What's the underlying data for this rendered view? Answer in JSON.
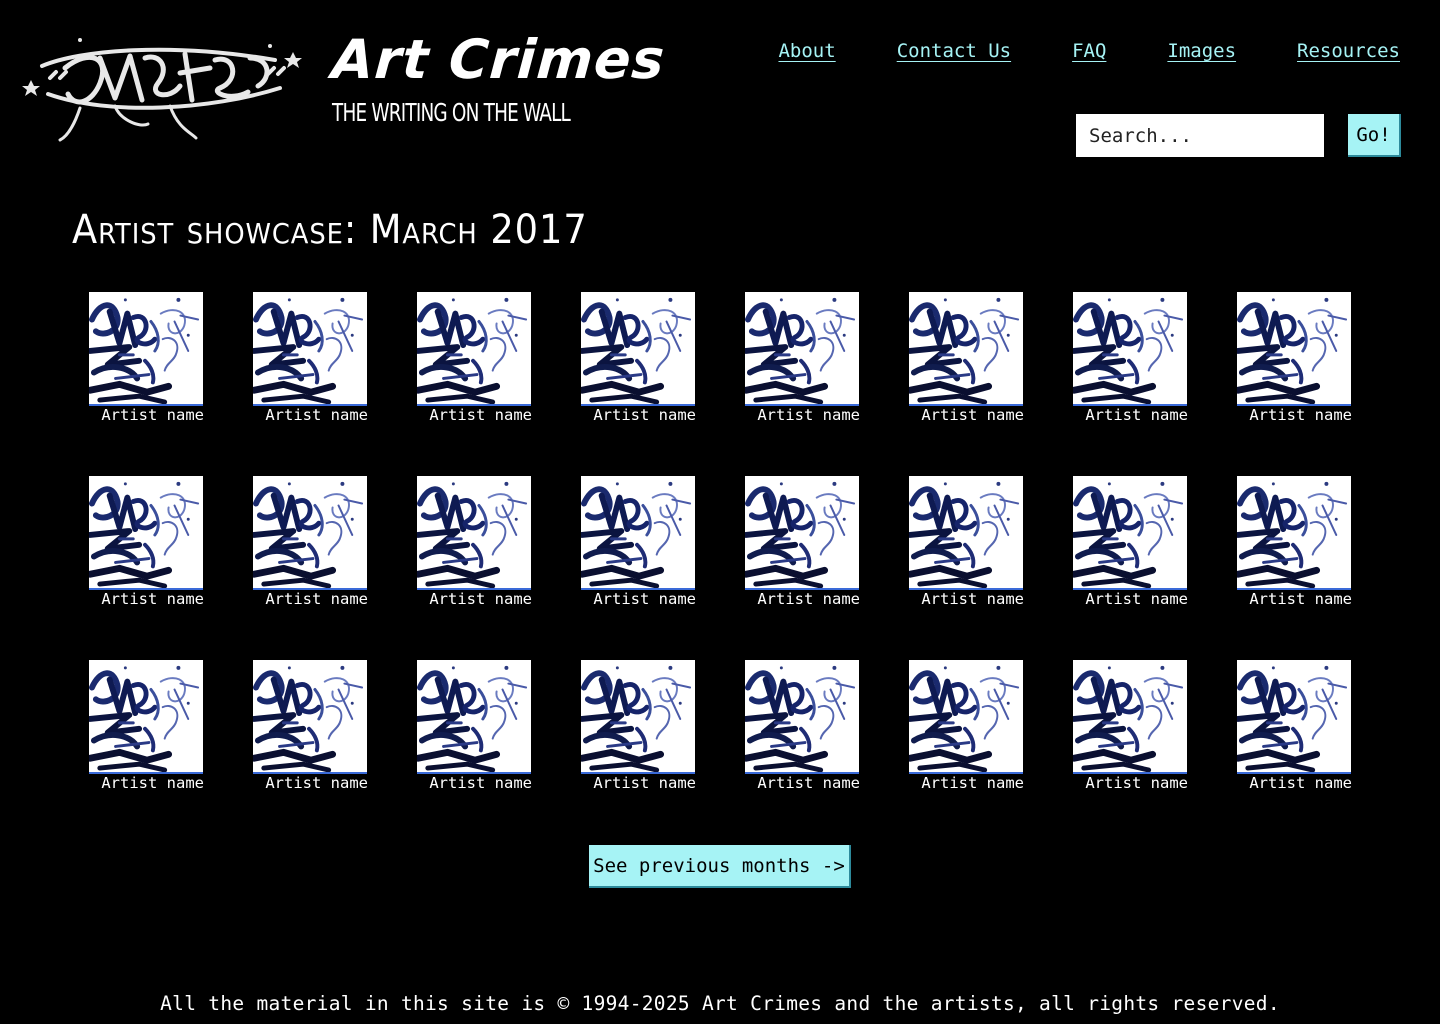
{
  "header": {
    "title": "Art Crimes",
    "tagline": "The Writing on the Wall",
    "nav": [
      {
        "label": "About"
      },
      {
        "label": "Contact Us"
      },
      {
        "label": "FAQ"
      },
      {
        "label": "Images"
      },
      {
        "label": "Resources"
      }
    ],
    "search": {
      "placeholder": "Search...",
      "value": "",
      "button_label": "Go!"
    }
  },
  "main": {
    "title": "Artist showcase: March 2017",
    "artists": [
      {
        "name": "Artist name"
      },
      {
        "name": "Artist name"
      },
      {
        "name": "Artist name"
      },
      {
        "name": "Artist name"
      },
      {
        "name": "Artist name"
      },
      {
        "name": "Artist name"
      },
      {
        "name": "Artist name"
      },
      {
        "name": "Artist name"
      },
      {
        "name": "Artist name"
      },
      {
        "name": "Artist name"
      },
      {
        "name": "Artist name"
      },
      {
        "name": "Artist name"
      },
      {
        "name": "Artist name"
      },
      {
        "name": "Artist name"
      },
      {
        "name": "Artist name"
      },
      {
        "name": "Artist name"
      },
      {
        "name": "Artist name"
      },
      {
        "name": "Artist name"
      },
      {
        "name": "Artist name"
      },
      {
        "name": "Artist name"
      },
      {
        "name": "Artist name"
      },
      {
        "name": "Artist name"
      },
      {
        "name": "Artist name"
      },
      {
        "name": "Artist name"
      }
    ],
    "previous_button_label": "See previous months ->"
  },
  "footer": {
    "text": "All the material in this site is © 1994-2025 Art Crimes and the artists, all rights reserved."
  },
  "colors": {
    "background": "#000000",
    "accent": "#a6f3f5",
    "text": "#ffffff"
  },
  "icons": {
    "logo": "graffiti-tag-logo",
    "thumbnail": "graffiti-artwork-thumbnail"
  }
}
